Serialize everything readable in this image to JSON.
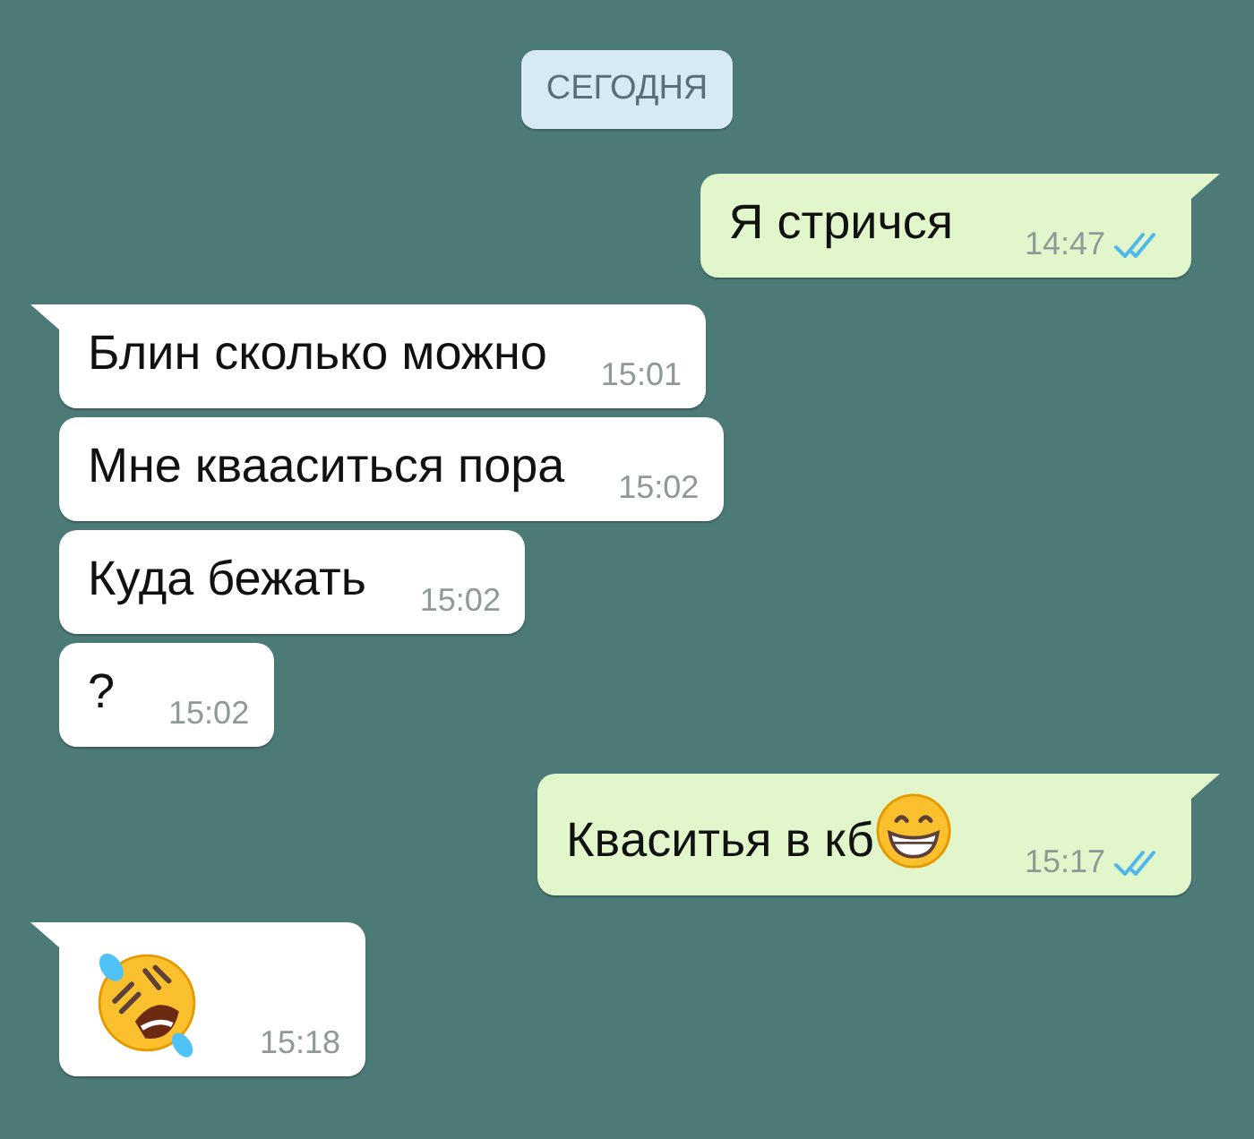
{
  "date_chip": "СЕГОДНЯ",
  "messages": [
    {
      "kind": "text",
      "outgoing": true,
      "tail": true,
      "text": "Я стричся",
      "time": "14:47",
      "read": true
    },
    {
      "kind": "text",
      "outgoing": false,
      "tail": true,
      "text": "Блин сколько можно",
      "time": "15:01"
    },
    {
      "kind": "text",
      "outgoing": false,
      "tail": false,
      "text": "Мне квааситься пора",
      "time": "15:02"
    },
    {
      "kind": "text",
      "outgoing": false,
      "tail": false,
      "text": "Куда бежать",
      "time": "15:02"
    },
    {
      "kind": "text",
      "outgoing": false,
      "tail": false,
      "text": "?",
      "time": "15:02"
    },
    {
      "kind": "text_icon",
      "outgoing": true,
      "tail": true,
      "text": "Квaситья в кб",
      "time": "15:17",
      "read": true
    },
    {
      "kind": "icon",
      "outgoing": false,
      "tail": true,
      "time": "15:18"
    }
  ]
}
